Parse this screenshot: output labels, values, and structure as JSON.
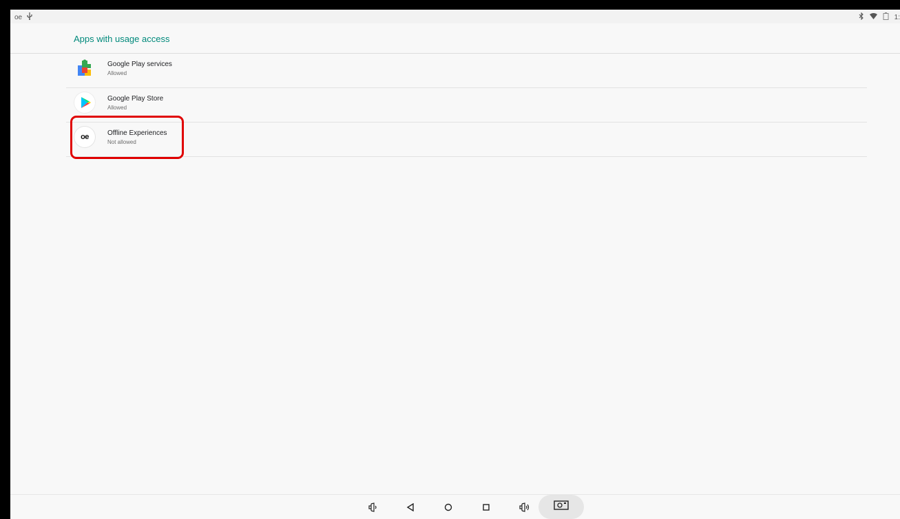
{
  "status_bar": {
    "left_icons": [
      "oe-icon",
      "usb-icon"
    ],
    "right_icons": [
      "bluetooth-icon",
      "wifi-icon",
      "battery-icon"
    ],
    "time": "1:"
  },
  "header": {
    "title": "Apps with usage access"
  },
  "apps": [
    {
      "name": "Google Play services",
      "status": "Allowed",
      "icon": "google-play-services-icon"
    },
    {
      "name": "Google Play Store",
      "status": "Allowed",
      "icon": "google-play-store-icon"
    },
    {
      "name": "Offline Experiences",
      "status": "Not allowed",
      "icon": "offline-experiences-icon",
      "icon_text": "oe"
    }
  ],
  "nav_bar": {
    "buttons": [
      "volume-down-icon",
      "back-icon",
      "home-icon",
      "recents-icon",
      "volume-up-icon",
      "screenshot-icon"
    ]
  },
  "colors": {
    "accent": "#00897b",
    "highlight": "#e00000",
    "background": "#f8f8f8"
  }
}
